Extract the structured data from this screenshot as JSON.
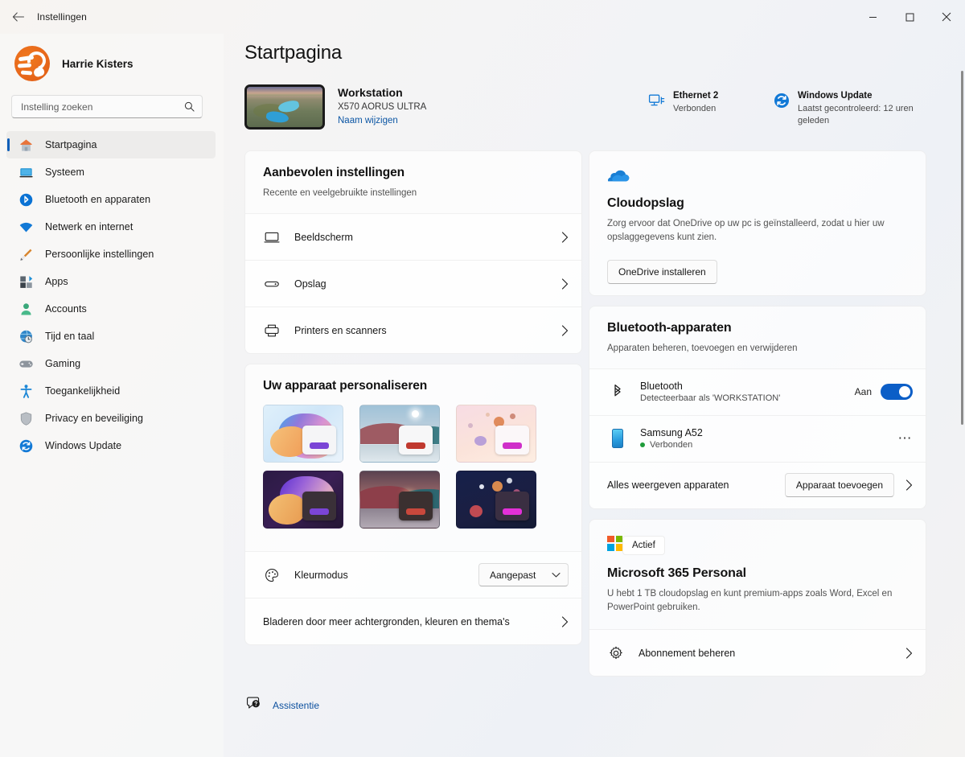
{
  "window": {
    "title": "Instellingen",
    "back_icon": "back-arrow-icon",
    "minimize_label": "–",
    "maximize_label": "☐",
    "close_label": "✕"
  },
  "sidebar": {
    "profile": {
      "name": "Harrie Kisters",
      "avatar": "user-avatar"
    },
    "search": {
      "placeholder": "Instelling zoeken",
      "value": "",
      "icon": "search-icon"
    },
    "items": [
      {
        "label": "Startpagina",
        "icon": "home-icon",
        "active": true
      },
      {
        "label": "Systeem",
        "icon": "system-icon",
        "active": false
      },
      {
        "label": "Bluetooth en apparaten",
        "icon": "bluetooth-icon",
        "active": false
      },
      {
        "label": "Netwerk en internet",
        "icon": "wifi-icon",
        "active": false
      },
      {
        "label": "Persoonlijke instellingen",
        "icon": "brush-icon",
        "active": false
      },
      {
        "label": "Apps",
        "icon": "apps-icon",
        "active": false
      },
      {
        "label": "Accounts",
        "icon": "account-icon",
        "active": false
      },
      {
        "label": "Tijd en taal",
        "icon": "clock-globe-icon",
        "active": false
      },
      {
        "label": "Gaming",
        "icon": "gamepad-icon",
        "active": false
      },
      {
        "label": "Toegankelijkheid",
        "icon": "accessibility-icon",
        "active": false
      },
      {
        "label": "Privacy en beveiliging",
        "icon": "shield-icon",
        "active": false
      },
      {
        "label": "Windows Update",
        "icon": "update-icon",
        "active": false
      }
    ]
  },
  "main": {
    "page_title": "Startpagina",
    "device": {
      "name": "Workstation",
      "model": "X570 AORUS ULTRA",
      "rename_link": "Naam wijzigen",
      "thumbnail": "device-wallpaper-thumbnail"
    },
    "status": [
      {
        "icon": "ethernet-icon",
        "title": "Ethernet 2",
        "subtitle": "Verbonden"
      },
      {
        "icon": "windows-update-icon",
        "title": "Windows Update",
        "subtitle": "Laatst gecontroleerd: 12 uren geleden"
      }
    ],
    "recommended": {
      "title": "Aanbevolen instellingen",
      "subtitle": "Recente en veelgebruikte instellingen",
      "rows": [
        {
          "label": "Beeldscherm",
          "icon": "display-icon"
        },
        {
          "label": "Opslag",
          "icon": "storage-icon"
        },
        {
          "label": "Printers en scanners",
          "icon": "printer-icon"
        }
      ]
    },
    "personalize": {
      "title": "Uw apparaat personaliseren",
      "themes": [
        {
          "name": "bloom-light",
          "accent": "#7b45d6"
        },
        {
          "name": "flow-light",
          "accent": "#c0392f"
        },
        {
          "name": "cosmos-light",
          "accent": "#cf2fc9"
        },
        {
          "name": "bloom-dark",
          "accent": "#7b45d6"
        },
        {
          "name": "flow-dark",
          "accent": "#c9483c"
        },
        {
          "name": "cosmos-dark",
          "accent": "#e330d8"
        }
      ],
      "color_mode": {
        "label": "Kleurmodus",
        "icon": "palette-icon",
        "value": "Aangepast"
      },
      "browse_more": "Bladeren door meer achtergronden, kleuren en thema's"
    },
    "cloud": {
      "icon": "onedrive-cloud-icon",
      "title": "Cloudopslag",
      "description": "Zorg ervoor dat OneDrive op uw pc is geïnstalleerd, zodat u hier uw opslaggegevens kunt zien.",
      "button": "OneDrive installeren"
    },
    "bluetooth": {
      "title": "Bluetooth-apparaten",
      "subtitle": "Apparaten beheren, toevoegen en verwijderen",
      "toggle_row": {
        "icon": "bluetooth-icon",
        "label": "Bluetooth",
        "sub": "Detecteerbaar als 'WORKSTATION'",
        "state_label": "Aan",
        "state_on": true
      },
      "device_row": {
        "icon": "phone-icon",
        "label": "Samsung A52",
        "status": "Verbonden",
        "more_icon": "more-options-icon"
      },
      "footer": {
        "link": "Alles weergeven apparaten",
        "button": "Apparaat toevoegen"
      }
    },
    "microsoft365": {
      "logo": "microsoft-logo",
      "badge": "Actief",
      "title": "Microsoft 365 Personal",
      "description": "U hebt 1 TB cloudopslag en kunt premium-apps zoals Word, Excel en PowerPoint gebruiken.",
      "manage_row": {
        "label": "Abonnement beheren",
        "icon": "gear-icon"
      }
    },
    "assistance": {
      "label": "Assistentie",
      "icon": "help-bubble-icon"
    }
  },
  "colors": {
    "accent_blue": "#0b5ec7",
    "link_blue": "#0b56a4",
    "avatar_orange": "#e8681b",
    "status_green": "#1f9c3a"
  }
}
